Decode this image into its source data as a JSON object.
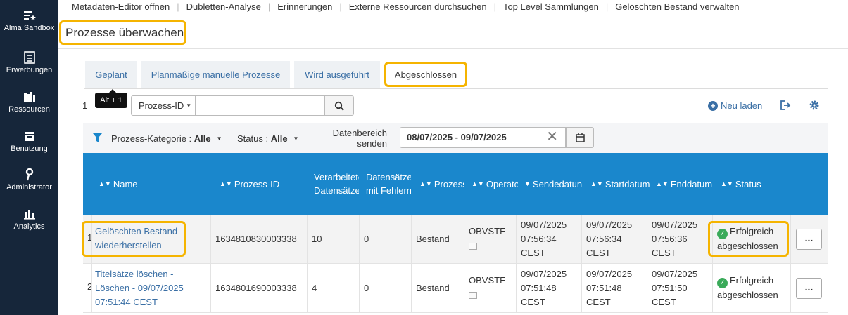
{
  "nav": [
    {
      "label": "Alma Sandbox",
      "icon": "menu-star-icon"
    },
    {
      "label": "Erwerbungen",
      "icon": "acquisitions-icon"
    },
    {
      "label": "Ressourcen",
      "icon": "books-icon"
    },
    {
      "label": "Benutzung",
      "icon": "inbox-icon"
    },
    {
      "label": "Administrator",
      "icon": "key-icon"
    },
    {
      "label": "Analytics",
      "icon": "bar-chart-icon"
    }
  ],
  "topmenu": [
    "Metadaten-Editor öffnen",
    "Dubletten-Analyse",
    "Erinnerungen",
    "Externe Ressourcen durchsuchen",
    "Top Level Sammlungen",
    "Gelöschten Bestand verwalten"
  ],
  "page_title": "Prozesse überwachen",
  "tabs": [
    "Geplant",
    "Planmäßige manuelle Prozesse",
    "Wird ausgeführt",
    "Abgeschlossen"
  ],
  "tooltip": "Alt + 1",
  "range_text": "1",
  "search": {
    "field_label": "Prozess-ID",
    "search_icon": "search-icon"
  },
  "reload_label": "Neu laden",
  "filters": {
    "category_label": "Prozess-Kategorie :",
    "category_value": "Alle",
    "status_label": "Status :",
    "status_value": "Alle",
    "date_label": "Datenbereich senden",
    "date_value": "08/07/2025 - 09/07/2025"
  },
  "table": {
    "headers": [
      "Name",
      "Prozess-ID",
      "Verarbeitete Datensätze",
      "Datensätze mit Fehlern",
      "Prozessk",
      "Operator",
      "Sendedatun",
      "Startdatum",
      "Enddatum",
      "Status"
    ],
    "rows": [
      {
        "index": "1",
        "name": "Gelöschten Bestand wiederherstellen",
        "id": "1634810830003338",
        "processed": "10",
        "errors": "0",
        "type": "Bestand",
        "operator": "OBVSTE",
        "send": "09/07/2025 07:56:34 CEST",
        "start": "09/07/2025 07:56:34 CEST",
        "end": "09/07/2025 07:56:36 CEST",
        "status": "Erfolgreich abgeschlossen",
        "more": "..."
      },
      {
        "index": "2",
        "name": "Titelsätze löschen - Löschen - 09/07/2025 07:51:44 CEST",
        "id": "1634801690003338",
        "processed": "4",
        "errors": "0",
        "type": "Bestand",
        "operator": "OBVSTE",
        "send": "09/07/2025 07:51:48 CEST",
        "start": "09/07/2025 07:51:48 CEST",
        "end": "09/07/2025 07:51:50 CEST",
        "status": "Erfolgreich abgeschlossen",
        "more": "..."
      }
    ]
  },
  "colors": {
    "nav_bg": "#16263a",
    "header_bg": "#1a87cc",
    "highlight": "#f5b400",
    "link": "#3a6fa5",
    "success": "#3aaa5a"
  }
}
